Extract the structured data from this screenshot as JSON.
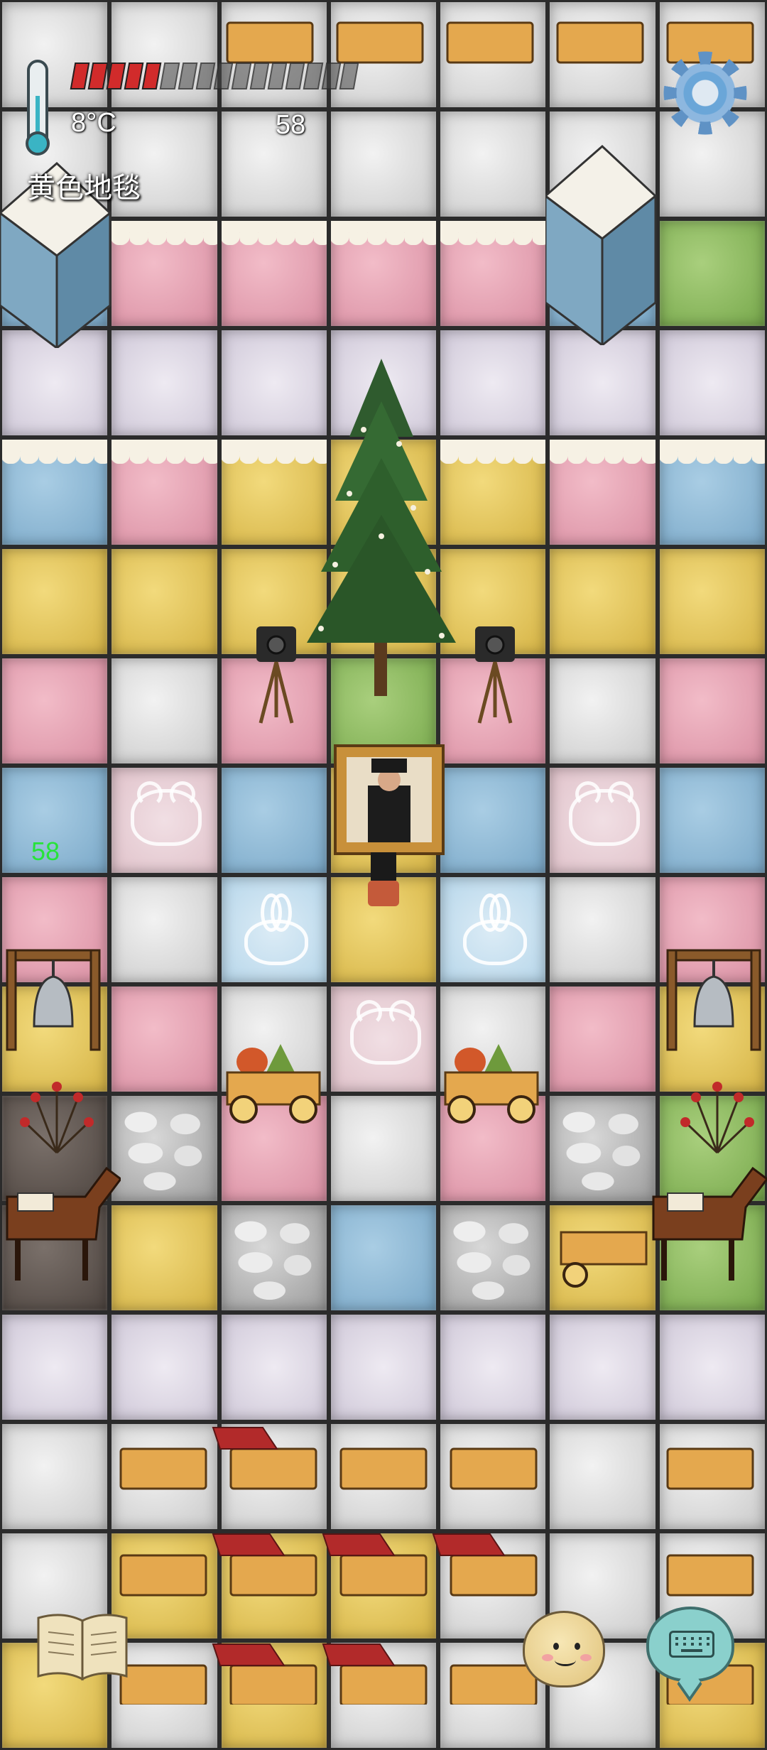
{
  "hud": {
    "temperature": "8°C",
    "food_value": "58",
    "held_item": "黄色地毯",
    "food_meter": {
      "filled_segments": 5,
      "total_segments": 16
    },
    "age_label": "58"
  },
  "icons": {
    "thermometer": "thermometer-icon",
    "settings": "gear-icon",
    "recipe_book": "book-icon",
    "emote": "smiley-face-icon",
    "chat": "keyboard-icon"
  },
  "colors": {
    "food_bar": "#d12b2b",
    "age_text": "#27e33a",
    "thermometer_fill": "#3ab4c4"
  },
  "board": {
    "columns": 7,
    "rows": 16,
    "tiles": [
      "white",
      "white",
      "white",
      "white",
      "white",
      "white",
      "white",
      "white",
      "white",
      "white",
      "white",
      "white",
      "white",
      "white",
      "blue",
      "pink",
      "pink",
      "pink",
      "pink",
      "blue",
      "green",
      "lilac",
      "lilac",
      "lilac",
      "lilac",
      "lilac",
      "lilac",
      "lilac",
      "blue",
      "pink",
      "yellow",
      "yellow",
      "yellow",
      "pink",
      "blue",
      "yellow",
      "yellow",
      "yellow",
      "yellow",
      "yellow",
      "yellow",
      "yellow",
      "pink",
      "white",
      "pink",
      "green",
      "pink",
      "white",
      "pink",
      "blue",
      "palepink",
      "blue",
      "yellow",
      "blue",
      "palepink",
      "blue",
      "pink",
      "white",
      "lightblue",
      "yellow",
      "lightblue",
      "white",
      "pink",
      "yellow",
      "pink",
      "white",
      "palepink",
      "white",
      "pink",
      "yellow",
      "dark",
      "stone",
      "pink",
      "white",
      "pink",
      "stone",
      "green",
      "dark",
      "yellow",
      "stone",
      "blue",
      "stone",
      "yellow",
      "green",
      "lilac",
      "lilac",
      "lilac",
      "lilac",
      "lilac",
      "lilac",
      "lilac",
      "white",
      "white",
      "white",
      "white",
      "white",
      "white",
      "white",
      "white",
      "yellow",
      "yellow",
      "yellow",
      "white",
      "white",
      "white",
      "yellow",
      "white",
      "yellow",
      "white",
      "white",
      "white",
      "yellow"
    ]
  },
  "objects": [
    "decorated-pine-tree",
    "camera-on-tripod",
    "camera-on-tripod",
    "framed-portrait",
    "player-character",
    "hanging-bell",
    "hanging-bell",
    "vegetable-cart",
    "vegetable-cart",
    "rose-bush",
    "rose-bush",
    "horse-with-cart",
    "horse-with-cart",
    "empty-cart",
    "wooden-crate-row",
    "red-cloth-pile",
    "snow-topped-pillar",
    "snow-topped-pillar"
  ]
}
